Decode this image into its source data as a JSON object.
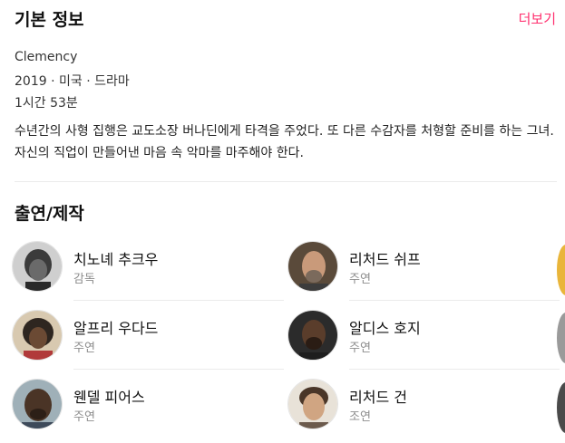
{
  "basic_info": {
    "title": "기본 정보",
    "more_label": "더보기",
    "original_title": "Clemency",
    "meta": "2019 · 미국 · 드라마",
    "runtime": "1시간 53분",
    "synopsis": "수년간의 사형 집행은 교도소장 버나딘에게 타격을 주었다. 또 다른 수감자를 처형할 준비를 하는 그녀. 자신의 직업이 만들어낸 마음 속 악마를 마주해야 한다."
  },
  "cast": {
    "title": "출연/제작",
    "members": [
      {
        "name": "치노녜 추크우",
        "role": "감독"
      },
      {
        "name": "리처드 쉬프",
        "role": "주연"
      },
      {
        "name": "알프리 우다드",
        "role": "주연"
      },
      {
        "name": "알디스 호지",
        "role": "주연"
      },
      {
        "name": "웬델 피어스",
        "role": "주연"
      },
      {
        "name": "리처드 건",
        "role": "조연"
      }
    ]
  },
  "colors": {
    "accent": "#ff2f6e",
    "secondary_text": "#8c8c8c",
    "divider": "#ebebeb"
  }
}
